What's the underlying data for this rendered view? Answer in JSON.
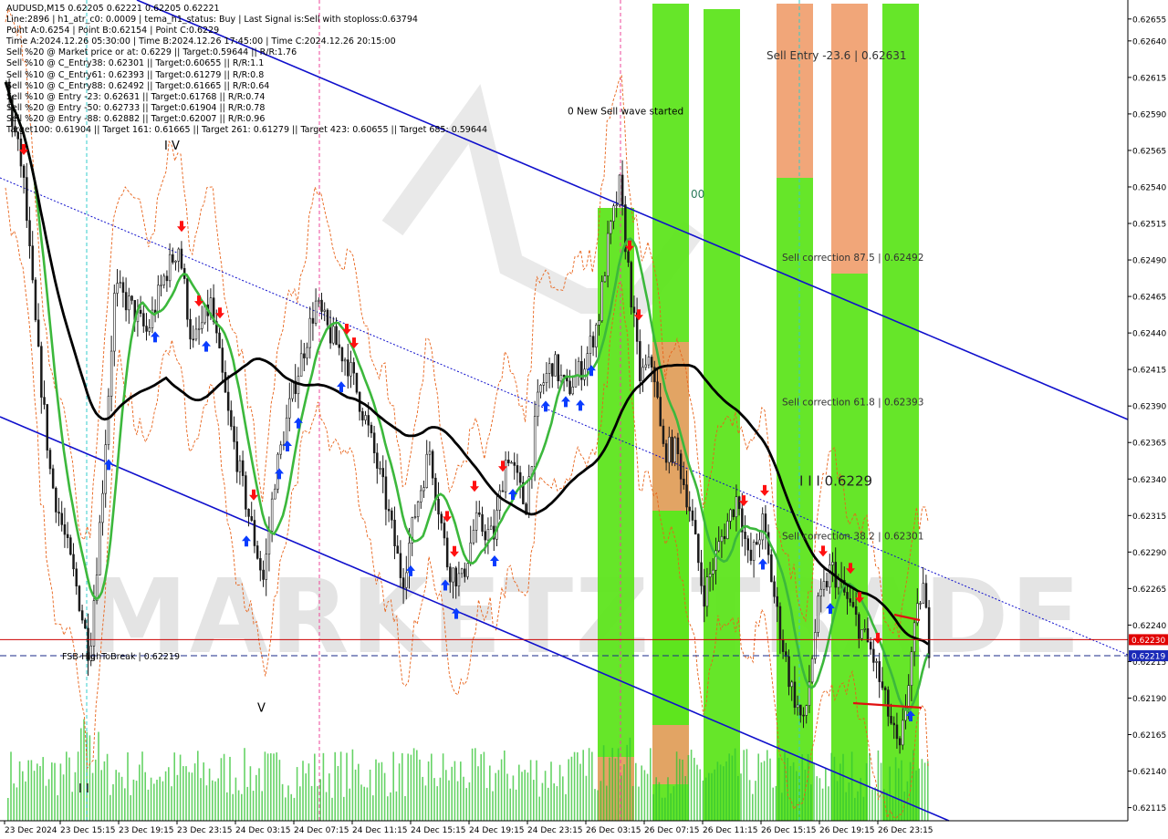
{
  "chart_data": {
    "type": "candlestick",
    "symbol": "AUDUSD,M15",
    "ohlc_header": "0.62205 0.62221 0.62205 0.62221",
    "ylim": [
      0.62105,
      0.6268
    ],
    "y_ticks": [
      "0.62655",
      "0.62640",
      "0.62615",
      "0.62590",
      "0.62565",
      "0.62540",
      "0.62515",
      "0.62490",
      "0.62465",
      "0.62440",
      "0.62415",
      "0.62390",
      "0.62365",
      "0.62340",
      "0.62315",
      "0.62290",
      "0.62265",
      "0.62240",
      "0.62215",
      "0.62190",
      "0.62165",
      "0.62140",
      "0.62115"
    ],
    "y_tick_values": [
      0.62655,
      0.6264,
      0.62615,
      0.6259,
      0.62565,
      0.6254,
      0.62515,
      0.6249,
      0.62465,
      0.6244,
      0.62415,
      0.6239,
      0.62365,
      0.6234,
      0.62315,
      0.6229,
      0.62265,
      0.6224,
      0.62215,
      0.6219,
      0.62165,
      0.6214,
      0.62115
    ],
    "x_ticks": [
      "23 Dec 2024",
      "23 Dec 15:15",
      "23 Dec 19:15",
      "23 Dec 23:15",
      "24 Dec 03:15",
      "24 Dec 07:15",
      "24 Dec 11:15",
      "24 Dec 15:15",
      "24 Dec 19:15",
      "24 Dec 23:15",
      "26 Dec 03:15",
      "26 Dec 07:15",
      "26 Dec 11:15",
      "26 Dec 15:15",
      "26 Dec 19:15",
      "26 Dec 23:15"
    ],
    "current_price_label": "0.62219",
    "red_level_label": "0.62230",
    "current_price": 0.62219,
    "red_level": 0.6223,
    "info_lines": [
      "AUDUSD,M15  0.62205 0.62221 0.62205 0.62221",
      "Line:2896 | h1_atr_c0: 0.0009 | tema_h1_status: Buy | Last Signal is:Sell with stoploss:0.63794",
      "Point A:0.6254 | Point B:0.62154 | Point C:0.6229",
      "Time A:2024.12.26 05:30:00 | Time B:2024.12.26 17:45:00 | Time C:2024.12.26 20:15:00",
      "Sell %20 @ Market price or at: 0.6229 || Target:0.59644 || R/R:1.76",
      "Sell %10 @ C_Entry38: 0.62301 || Target:0.60655 || R/R:1.1",
      "Sell %10 @ C_Entry61: 0.62393 || Target:0.61279 || R/R:0.8",
      "Sell %10 @ C_Entry88: 0.62492 || Target:0.61665 || R/R:0.64",
      "Sell %10 @ Entry -23: 0.62631 || Target:0.61768 || R/R:0.74",
      "Sell %20 @ Entry -50: 0.62733 || Target:0.61904 || R/R:0.78",
      "Sell %20 @ Entry -88: 0.62882 || Target:0.62007 || R/R:0.96",
      "Target100: 0.61904 || Target 161: 0.61665 || Target 261: 0.61279 || Target 423: 0.60655 || Target 685: 0.59644"
    ],
    "annotations": [
      {
        "text": "Sell Entry -23.6 | 0.62631",
        "price": 0.6263
      },
      {
        "text": "Sell correction 87.5 | 0.62492",
        "price": 0.62492
      },
      {
        "text": "Sell correction 61.8 | 0.62393",
        "price": 0.62393
      },
      {
        "text": "Sell correction 38.2 | 0.62301",
        "price": 0.62301
      },
      {
        "text": "0 New Sell wave started",
        "price": 0.62592
      },
      {
        "text": "FSB-HighToBreak | 0.62219",
        "price": 0.62219
      },
      {
        "text": "I I I 0.6229",
        "price": 0.62338
      },
      {
        "text": "I V",
        "price": 0.62568
      },
      {
        "text": "V",
        "price": 0.62183
      },
      {
        "text": "I I",
        "price": 0.62128
      },
      {
        "text": "00",
        "price": 0.62535
      }
    ],
    "watermark": "MARKETZITRADE",
    "colors": {
      "bull": "#1a1a1a",
      "bear": "#1a1a1a",
      "green_ma": "#3cb83c",
      "black_ma": "#000000",
      "channel": "#1010cc",
      "zone_green": "#5ee51e",
      "zone_orange": "#ef9c6a",
      "up_arrow": "#0a3cff",
      "down_arrow": "#ff1010",
      "price_line": "#cc0000",
      "current_line": "#1a2a8a"
    }
  }
}
